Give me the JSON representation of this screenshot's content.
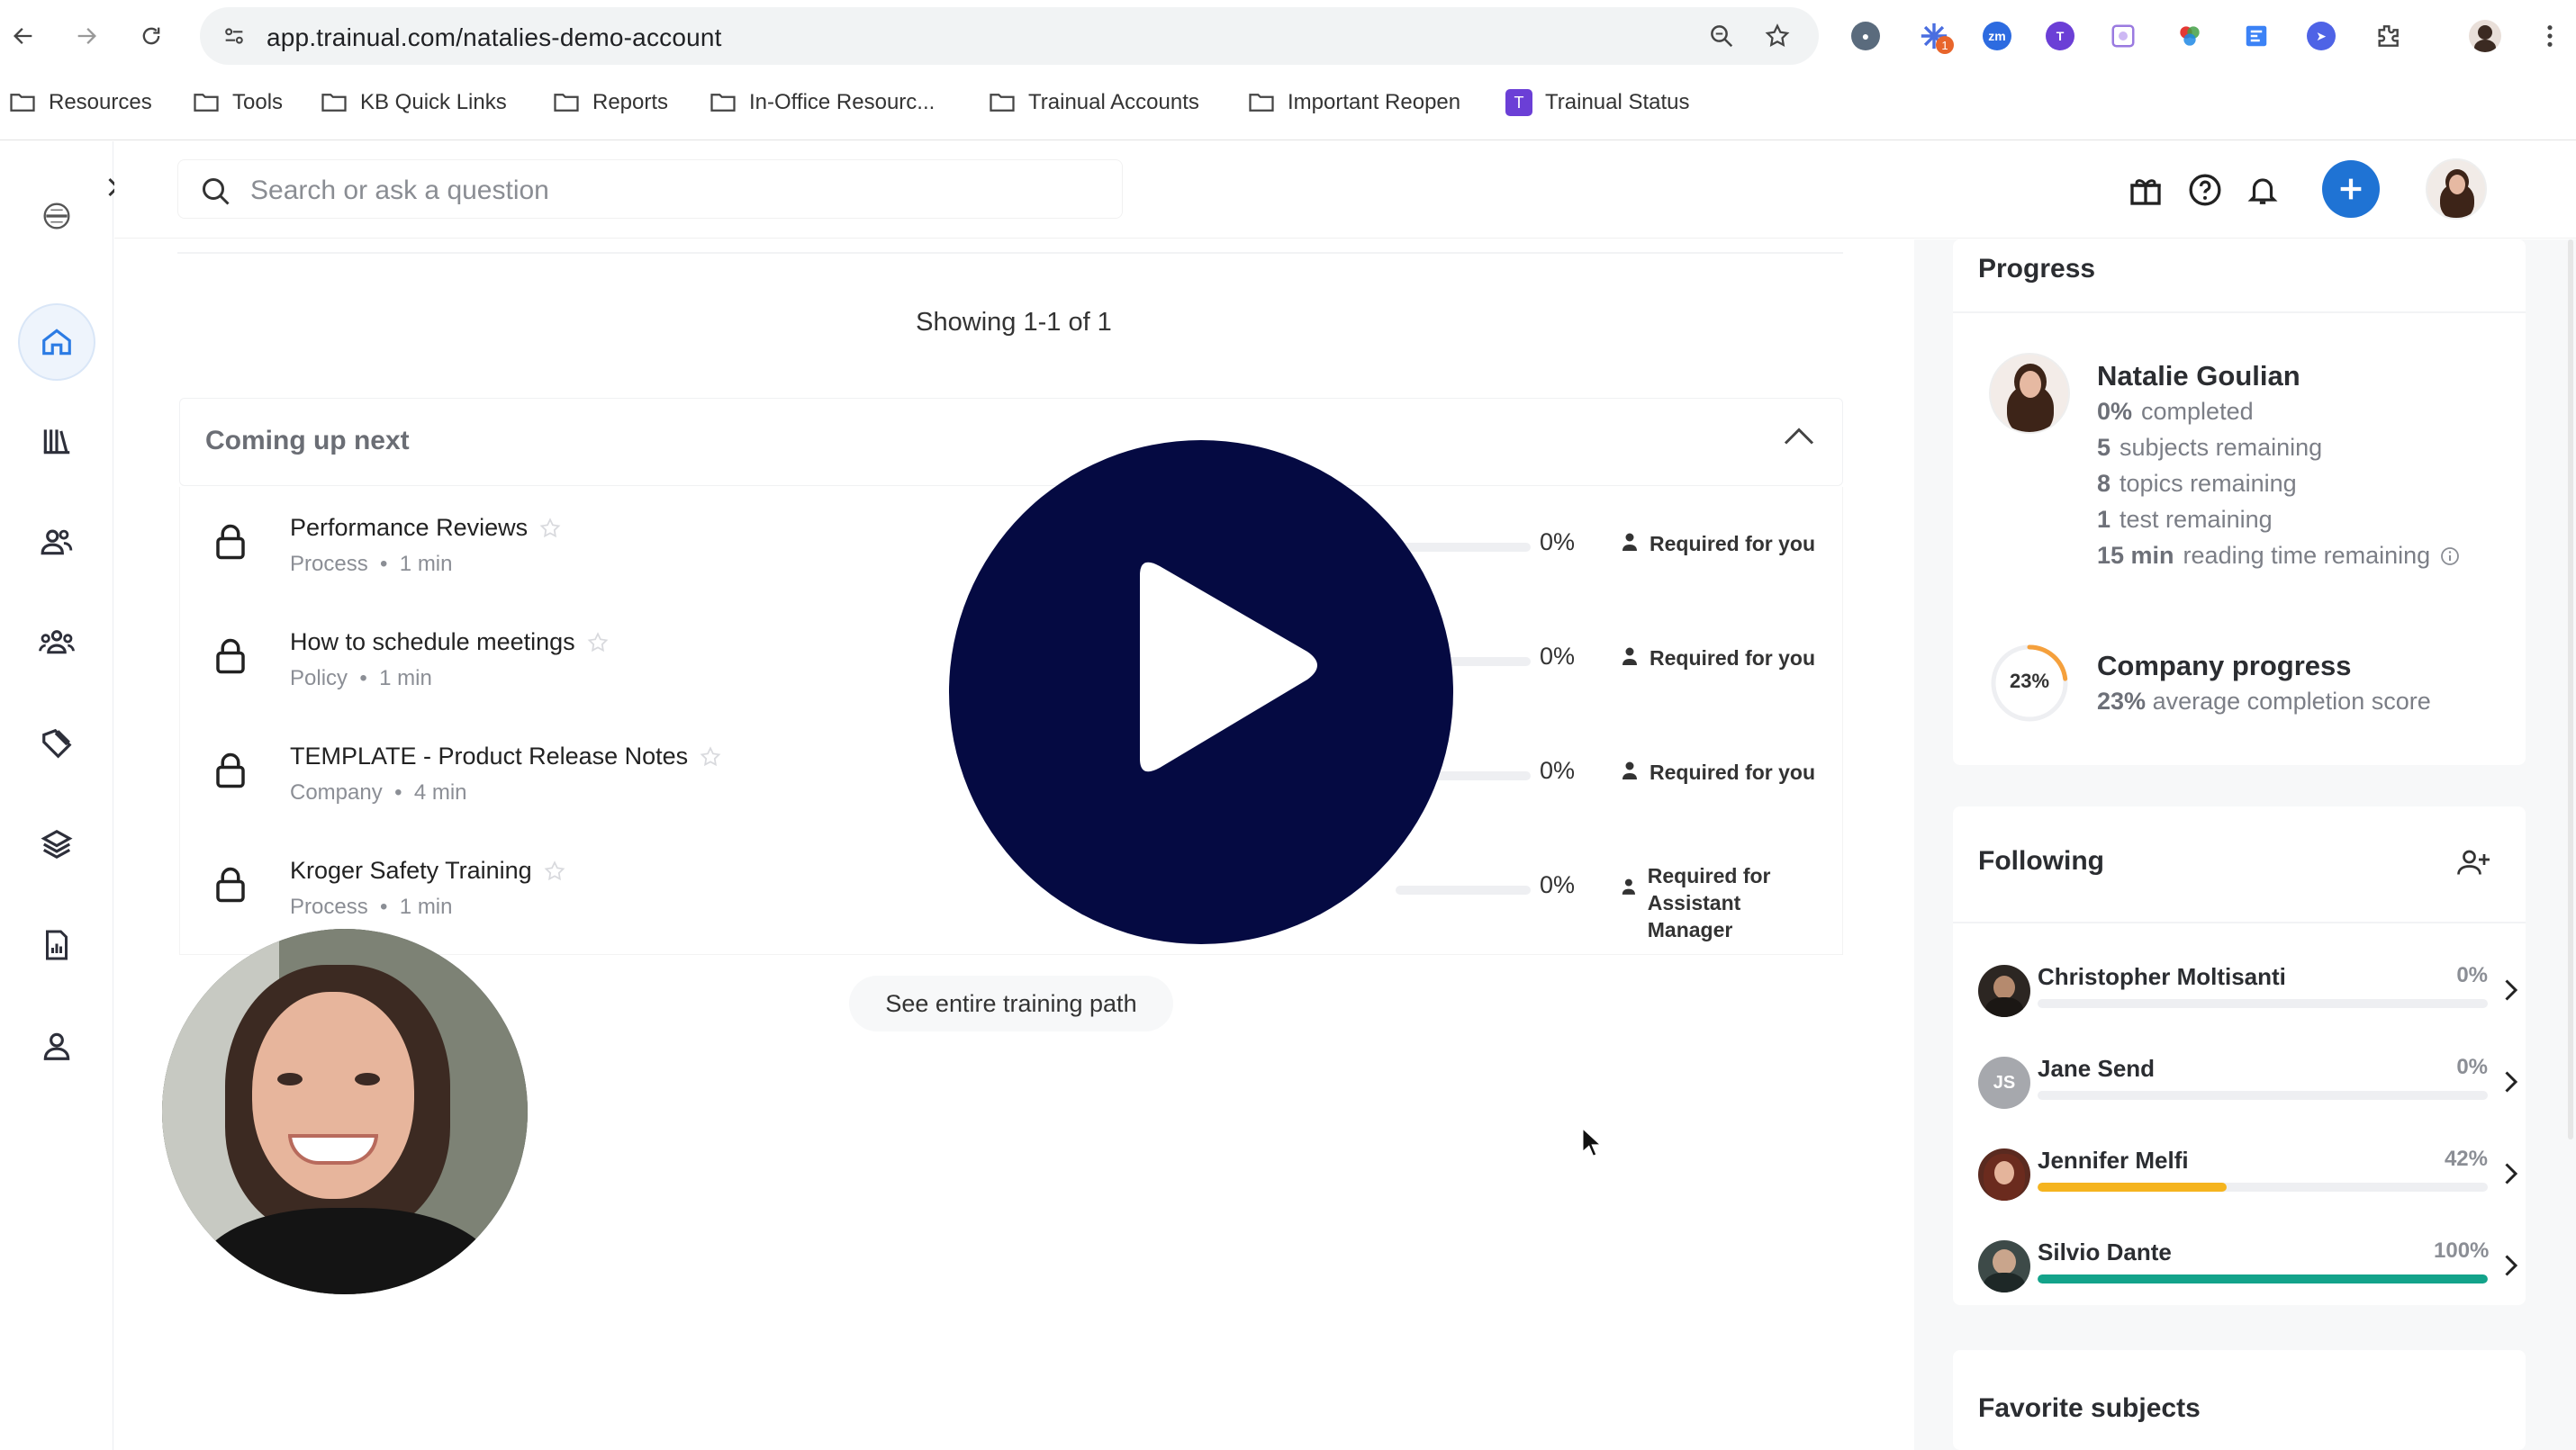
{
  "browser": {
    "url": "app.trainual.com/natalies-demo-account",
    "bookmarks": [
      {
        "label": "Resources"
      },
      {
        "label": "Tools"
      },
      {
        "label": "KB Quick Links"
      },
      {
        "label": "Reports"
      },
      {
        "label": "In-Office Resourc..."
      },
      {
        "label": "Trainual Accounts"
      },
      {
        "label": "Important Reopen"
      },
      {
        "label": "Trainual Status"
      }
    ],
    "extension_badge": "1",
    "extension_zm": "zm"
  },
  "topbar": {
    "search_placeholder": "Search or ask a question"
  },
  "main": {
    "showing": "Showing 1-1 of 1",
    "coming_up_title": "Coming up next",
    "rows": [
      {
        "title": "Performance Reviews",
        "type": "Process",
        "duration": "1 min",
        "percent": "0%",
        "requirement_1": "Required for you",
        "requirement_2": ""
      },
      {
        "title": "How to schedule meetings",
        "type": "Policy",
        "duration": "1 min",
        "percent": "0%",
        "requirement_1": "Required for you",
        "requirement_2": ""
      },
      {
        "title": "TEMPLATE - Product Release Notes",
        "type": "Company",
        "duration": "4 min",
        "percent": "0%",
        "requirement_1": "Required for you",
        "requirement_2": ""
      },
      {
        "title": "Kroger Safety Training",
        "type": "Process",
        "duration": "1 min",
        "percent": "0%",
        "requirement_1": "Required for Assistant",
        "requirement_2": "Manager"
      }
    ],
    "see_path": "See entire training path",
    "meta_separator": "•"
  },
  "progress": {
    "title": "Progress",
    "user_name": "Natalie Goulian",
    "completed_value": "0%",
    "completed_label": "completed",
    "subjects_value": "5",
    "subjects_label": "subjects remaining",
    "topics_value": "8",
    "topics_label": "topics remaining",
    "tests_value": "1",
    "tests_label": "test remaining",
    "reading_value": "15 min",
    "reading_label": "reading time remaining",
    "company_title": "Company progress",
    "company_percent": "23%",
    "company_score_label": "average completion score",
    "company_fraction": 0.23
  },
  "following": {
    "title": "Following",
    "people": [
      {
        "name": "Christopher Moltisanti",
        "percent": "0%",
        "fraction": 0.0,
        "initials": "",
        "color": "#9e9e9e"
      },
      {
        "name": "Jane Send",
        "percent": "0%",
        "fraction": 0.0,
        "initials": "JS",
        "color": "#9e9e9e"
      },
      {
        "name": "Jennifer Melfi",
        "percent": "42%",
        "fraction": 0.42,
        "initials": "",
        "color": "#f5b41f"
      },
      {
        "name": "Silvio Dante",
        "percent": "100%",
        "fraction": 1.0,
        "initials": "",
        "color": "#13a38a"
      }
    ]
  },
  "favorites": {
    "title": "Favorite subjects"
  },
  "colors": {
    "accent_blue": "#1f73d4",
    "play_navy": "#050a42",
    "ring_orange": "#f5a03c"
  }
}
